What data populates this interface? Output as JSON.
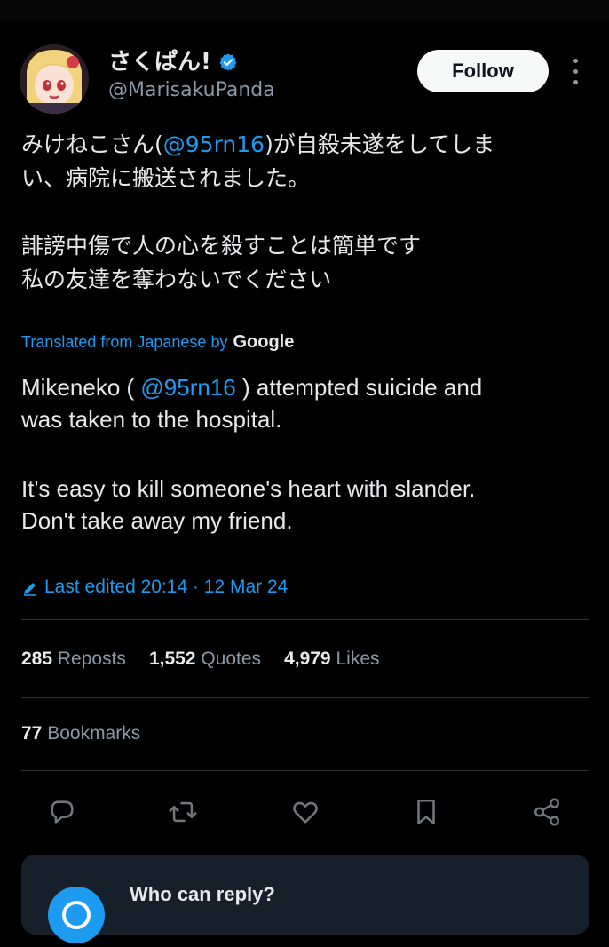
{
  "author": {
    "display_name": "さくぱん!",
    "handle": "@MarisakuPanda",
    "verified": true
  },
  "follow_button": {
    "label": "Follow"
  },
  "post": {
    "original": {
      "line1_prefix": "みけねこさん(",
      "mention": "@95rn16",
      "line1_suffix": ")が自殺未遂をしてしま",
      "line2": "い、病院に搬送されました。",
      "line3": "誹謗中傷で人の心を殺すことは簡単です",
      "line4": "私の友達を奪わないでください"
    },
    "translation": {
      "label": "Translated from Japanese by",
      "provider": "Google"
    },
    "translated": {
      "line1_prefix": "Mikeneko ( ",
      "mention": "@95rn16",
      "line1_suffix": " ) attempted suicide and",
      "line2": "was taken to the hospital.",
      "line3": "It's easy to kill someone's heart with slander.",
      "line4": "Don't take away my friend."
    },
    "edited": "Last edited 20:14 · 12 Mar 24"
  },
  "stats": {
    "reposts_count": "285",
    "reposts_label": "Reposts",
    "quotes_count": "1,552",
    "quotes_label": "Quotes",
    "likes_count": "4,979",
    "likes_label": "Likes",
    "bookmarks_count": "77",
    "bookmarks_label": "Bookmarks"
  },
  "actions": [
    "reply-icon",
    "repost-icon",
    "like-icon",
    "bookmark-icon",
    "share-icon"
  ],
  "reply_settings": {
    "title": "Who can reply?"
  },
  "colors": {
    "background": "#000000",
    "text": "#e7e9ea",
    "secondary": "#8b98a5",
    "accent": "#1d9bf0",
    "divider": "#2f3336",
    "card": "#16202a"
  }
}
